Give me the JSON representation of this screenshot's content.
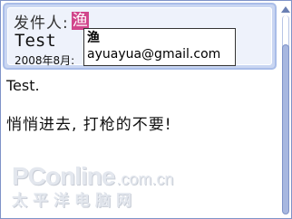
{
  "header": {
    "from_label": "发件人:",
    "from_name": "渔",
    "subject": "Test",
    "date": "2008年8月:"
  },
  "tooltip": {
    "name": "渔",
    "email": "ayuayua@gmail.com"
  },
  "body": {
    "line1": "Test.",
    "line2": "悄悄进去, 打枪的不要!"
  },
  "watermark": {
    "logo": "PConline",
    "domain": ".com.cn",
    "cn": "太平洋电脑网"
  },
  "colors": {
    "accent": "#d1468c",
    "header_bg": "#c9d6f2",
    "scrollbar": "#a7b7e0"
  }
}
